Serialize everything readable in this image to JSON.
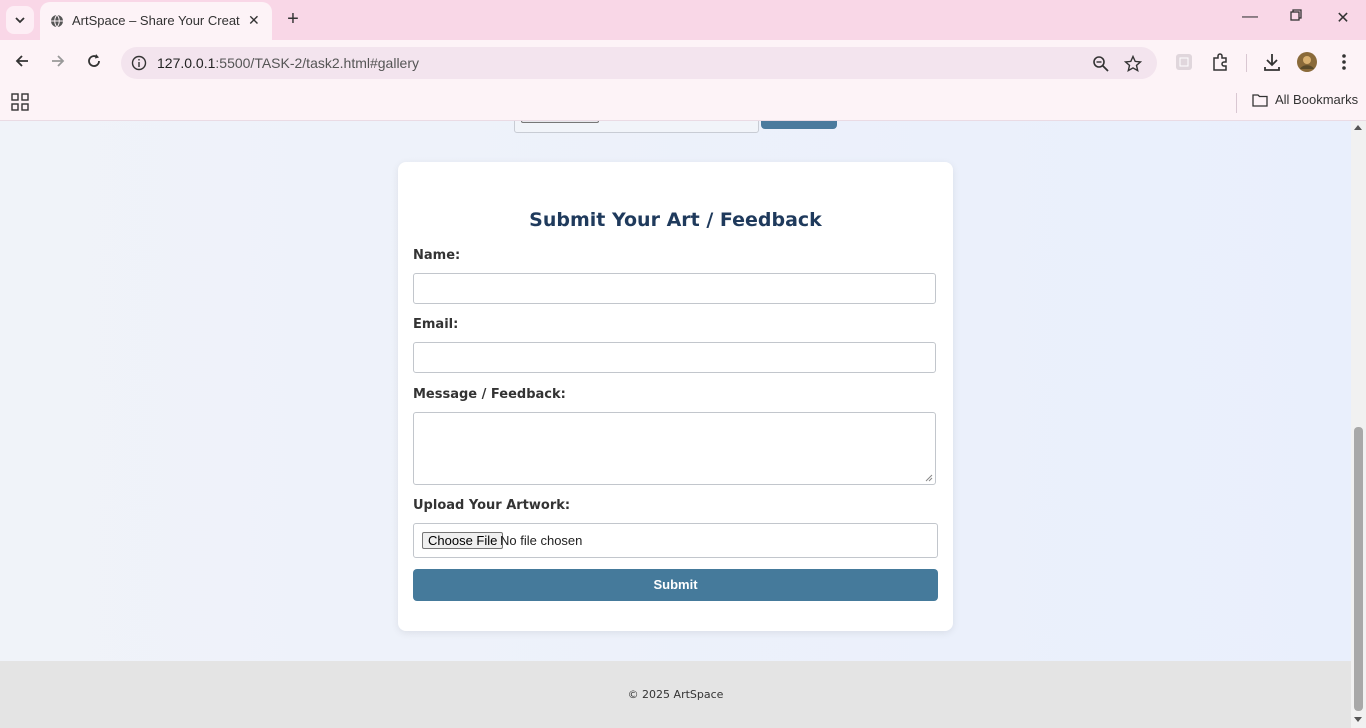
{
  "browser": {
    "tab_title": "ArtSpace – Share Your Creativity",
    "url_host": "127.0.0.1",
    "url_path": ":5500/TASK-2/task2.html#gallery",
    "bookmarks_label": "All Bookmarks"
  },
  "form": {
    "heading": "Submit Your Art / Feedback",
    "name_label": "Name:",
    "email_label": "Email:",
    "message_label": "Message / Feedback:",
    "upload_label": "Upload Your Artwork:",
    "choose_file_label": "Choose File",
    "file_status": "No file chosen",
    "submit_label": "Submit"
  },
  "footer": {
    "copyright": "© 2025 ArtSpace"
  },
  "colors": {
    "accent": "#457a9b",
    "heading": "#1f3a5c",
    "tabstrip": "#f9d7e7"
  }
}
